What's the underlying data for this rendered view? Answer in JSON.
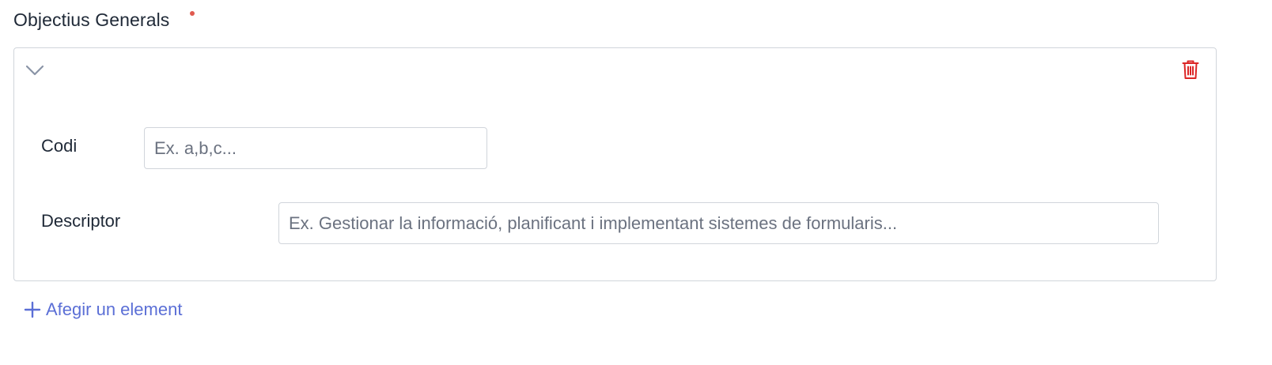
{
  "section": {
    "label": "Objectius Generals",
    "required_color": "#e05a4f"
  },
  "item": {
    "collapse_icon": "chevron-down-icon",
    "delete_icon": "trash-icon",
    "delete_color": "#dc2626",
    "fields": {
      "codi": {
        "label": "Codi",
        "value": "",
        "placeholder": "Ex. a,b,c..."
      },
      "descriptor": {
        "label": "Descriptor",
        "value": "",
        "placeholder": "Ex. Gestionar la informació, planificant i implementant sistemes de formularis..."
      }
    }
  },
  "add_button": {
    "label": "Afegir un element",
    "icon": "plus-icon",
    "color": "#5b6fd6"
  }
}
